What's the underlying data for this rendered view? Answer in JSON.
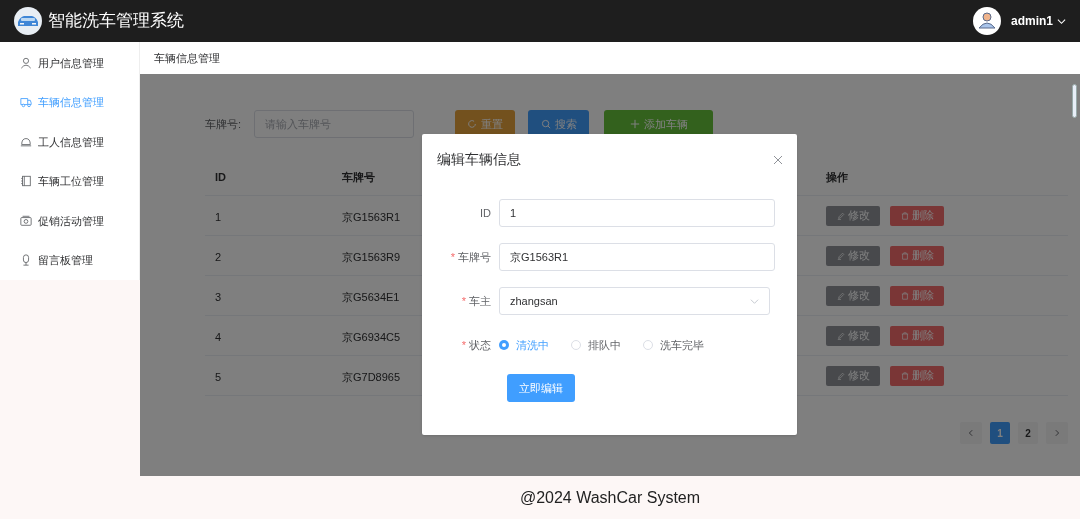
{
  "header": {
    "title": "智能洗车管理系统",
    "user": "admin1"
  },
  "sidebar": {
    "items": [
      {
        "label": "用户信息管理",
        "selected": false
      },
      {
        "label": "车辆信息管理",
        "selected": true
      },
      {
        "label": "工人信息管理",
        "selected": false
      },
      {
        "label": "车辆工位管理",
        "selected": false
      },
      {
        "label": "促销活动管理",
        "selected": false
      },
      {
        "label": "留言板管理",
        "selected": false
      }
    ]
  },
  "breadcrumb": "车辆信息管理",
  "search": {
    "label": "车牌号:",
    "placeholder": "请输入车牌号"
  },
  "toolbar_buttons": [
    {
      "label": "重置",
      "kind": "reset"
    },
    {
      "label": "搜索",
      "kind": "search"
    },
    {
      "label": "添加车辆",
      "kind": "add"
    }
  ],
  "table": {
    "columns": [
      "ID",
      "车牌号",
      "操作"
    ],
    "rows": [
      {
        "id": "1",
        "plate": "京G1563R1",
        "actions": [
          "修改",
          "删除"
        ]
      },
      {
        "id": "2",
        "plate": "京G1563R9",
        "actions": [
          "修改",
          "删除"
        ]
      },
      {
        "id": "3",
        "plate": "京G5634E1",
        "actions": [
          "修改",
          "删除"
        ]
      },
      {
        "id": "4",
        "plate": "京G6934C5",
        "actions": [
          "修改",
          "删除"
        ]
      },
      {
        "id": "5",
        "plate": "京G7D8965",
        "actions": [
          "修改",
          "删除"
        ]
      }
    ]
  },
  "pagination": {
    "pages": [
      {
        "label": "1",
        "selected": true
      },
      {
        "label": "2",
        "selected": false
      }
    ]
  },
  "dialog": {
    "title": "编辑车辆信息",
    "fields": [
      {
        "kind": "input",
        "label": "ID",
        "value": "1"
      },
      {
        "kind": "input",
        "label": "车牌号",
        "required_mark": "*",
        "value": "京G1563R1"
      },
      {
        "kind": "select",
        "label": "车主",
        "required_mark": "*",
        "value": "zhangsan"
      },
      {
        "kind": "radio",
        "label": "状态",
        "required_mark": "*",
        "options": [
          {
            "label": "清洗中",
            "selected": true
          },
          {
            "label": "排队中",
            "selected": false
          },
          {
            "label": "洗车完毕",
            "selected": false
          }
        ]
      }
    ],
    "submit": "立即编辑"
  },
  "footer": "@2024 WashCar System"
}
